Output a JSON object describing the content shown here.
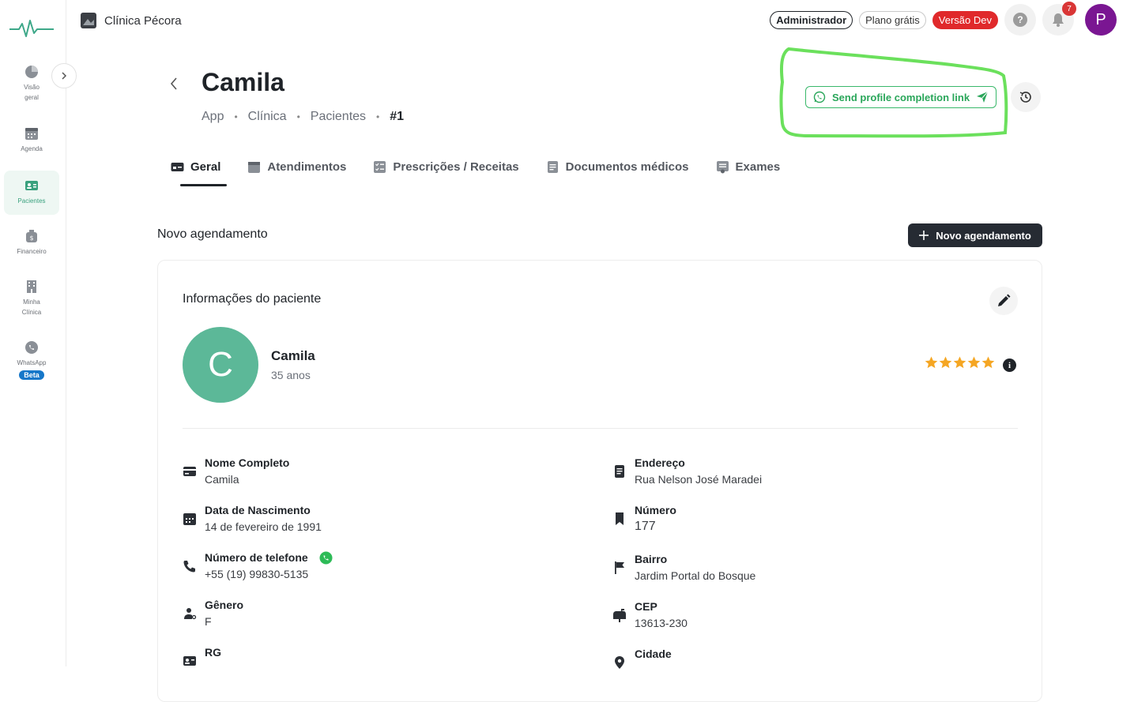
{
  "sidebar": {
    "items": [
      {
        "label": "Visão geral",
        "icon": "pie-chart-icon"
      },
      {
        "label": "Agenda",
        "icon": "calendar-icon"
      },
      {
        "label": "Pacientes",
        "icon": "patient-card-icon"
      },
      {
        "label": "Financeiro",
        "icon": "money-bag-icon"
      },
      {
        "label": "Minha Clínica",
        "icon": "building-icon"
      },
      {
        "label": "WhatsApp",
        "icon": "whatsapp-icon",
        "badge": "Beta"
      }
    ]
  },
  "topbar": {
    "clinic_name": "Clínica Pécora",
    "admin_label": "Administrador",
    "plan_label": "Plano grátis",
    "dev_label": "Versão Dev",
    "help_label": "?",
    "notifications_count": "7",
    "avatar_initial": "P"
  },
  "header": {
    "title": "Camila",
    "breadcrumb": [
      "App",
      "Clínica",
      "Pacientes",
      "#1"
    ],
    "send_link_label": "Send profile completion link"
  },
  "tabs": [
    {
      "label": "Geral",
      "active": true
    },
    {
      "label": "Atendimentos",
      "active": false
    },
    {
      "label": "Prescrições / Receitas",
      "active": false
    },
    {
      "label": "Documentos médicos",
      "active": false
    },
    {
      "label": "Exames",
      "active": false
    }
  ],
  "section": {
    "title": "Novo agendamento",
    "new_button_label": "Novo agendamento"
  },
  "patient_card": {
    "title": "Informações do paciente",
    "avatar_initial": "C",
    "name": "Camila",
    "age": "35 anos",
    "rating": 5,
    "info_label": "i",
    "left_fields": [
      {
        "label": "Nome Completo",
        "value": "Camila"
      },
      {
        "label": "Data de Nascimento",
        "value": "14 de fevereiro de 1991"
      },
      {
        "label": "Número de telefone",
        "value": "+55 (19) 99830-5135"
      },
      {
        "label": "Gênero",
        "value": "F"
      },
      {
        "label": "RG",
        "value": ""
      }
    ],
    "right_fields": [
      {
        "label": "Endereço",
        "value": "Rua Nelson José Maradei"
      },
      {
        "label": "Número",
        "value": "177"
      },
      {
        "label": "Bairro",
        "value": "Jardim Portal do Bosque"
      },
      {
        "label": "CEP",
        "value": "13613-230"
      },
      {
        "label": "Cidade",
        "value": ""
      }
    ]
  },
  "colors": {
    "accent_green": "#5cb898",
    "whatsapp_green": "#2aa65a",
    "dev_red": "#e0292b",
    "avatar_purple": "#7a1692",
    "dark_button": "#262b33",
    "star": "#f5a623"
  }
}
